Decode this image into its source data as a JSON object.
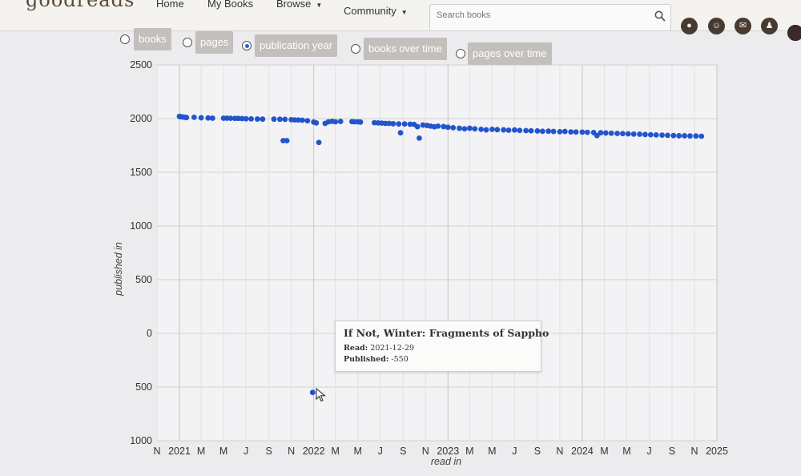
{
  "nav": {
    "logo": "goodreads",
    "home": "Home",
    "my_books": "My Books",
    "browse": "Browse",
    "community": "Community",
    "search_placeholder": "Search books"
  },
  "options": [
    {
      "label": "books",
      "selected": false
    },
    {
      "label": "pages",
      "selected": false
    },
    {
      "label": "publication year",
      "selected": true
    },
    {
      "label": "books over time",
      "selected": false
    },
    {
      "label": "pages over time",
      "selected": false
    }
  ],
  "tooltip": {
    "title": "If Not, Winter: Fragments of Sappho",
    "read_label": "Read:",
    "read_value": "2021-12-29",
    "published_label": "Published:",
    "published_value": "-550"
  },
  "chart_data": {
    "type": "scatter",
    "xlabel": "read in",
    "ylabel": "published in",
    "ylim": [
      -1000,
      2500
    ],
    "y_ticks": [
      2500,
      2000,
      1500,
      1000,
      500,
      0,
      -500,
      -1000
    ],
    "y_tick_labels": [
      "2500",
      "2000",
      "1500",
      "1000",
      "500",
      "0",
      "500",
      "1000"
    ],
    "xlim": [
      "2020-11-01",
      "2025-01-01"
    ],
    "x_tick_labels": [
      "N",
      "2021",
      "M",
      "M",
      "J",
      "S",
      "N",
      "2022",
      "M",
      "M",
      "J",
      "S",
      "N",
      "2023",
      "M",
      "M",
      "J",
      "S",
      "N",
      "2024",
      "M",
      "M",
      "J",
      "S",
      "N",
      "2025"
    ],
    "grid": true,
    "color": "#2255cc",
    "points": [
      {
        "x": "2021-01-01",
        "y": 2020
      },
      {
        "x": "2021-01-04",
        "y": 2018
      },
      {
        "x": "2021-01-08",
        "y": 2016
      },
      {
        "x": "2021-01-12",
        "y": 2014
      },
      {
        "x": "2021-01-16",
        "y": 2012
      },
      {
        "x": "2021-01-20",
        "y": 2010
      },
      {
        "x": "2021-02-10",
        "y": 2012
      },
      {
        "x": "2021-03-01",
        "y": 2008
      },
      {
        "x": "2021-03-20",
        "y": 2006
      },
      {
        "x": "2021-04-01",
        "y": 2004
      },
      {
        "x": "2021-05-01",
        "y": 2004
      },
      {
        "x": "2021-05-10",
        "y": 2004
      },
      {
        "x": "2021-05-20",
        "y": 2003
      },
      {
        "x": "2021-06-01",
        "y": 2002
      },
      {
        "x": "2021-06-10",
        "y": 2002
      },
      {
        "x": "2021-06-20",
        "y": 2000
      },
      {
        "x": "2021-07-01",
        "y": 1998
      },
      {
        "x": "2021-07-15",
        "y": 1997
      },
      {
        "x": "2021-08-01",
        "y": 1996
      },
      {
        "x": "2021-08-15",
        "y": 1995
      },
      {
        "x": "2021-09-15",
        "y": 1995
      },
      {
        "x": "2021-10-01",
        "y": 1994
      },
      {
        "x": "2021-10-15",
        "y": 1993
      },
      {
        "x": "2021-10-10",
        "y": 1795
      },
      {
        "x": "2021-10-20",
        "y": 1795
      },
      {
        "x": "2021-11-01",
        "y": 1990
      },
      {
        "x": "2021-11-10",
        "y": 1988
      },
      {
        "x": "2021-11-20",
        "y": 1987
      },
      {
        "x": "2021-12-01",
        "y": 1985
      },
      {
        "x": "2021-12-15",
        "y": 1980
      },
      {
        "x": "2021-12-29",
        "y": -550
      },
      {
        "x": "2022-01-01",
        "y": 1968
      },
      {
        "x": "2022-01-08",
        "y": 1960
      },
      {
        "x": "2022-01-15",
        "y": 1778
      },
      {
        "x": "2022-02-01",
        "y": 1955
      },
      {
        "x": "2022-02-10",
        "y": 1970
      },
      {
        "x": "2022-02-20",
        "y": 1975
      },
      {
        "x": "2022-03-01",
        "y": 1970
      },
      {
        "x": "2022-03-15",
        "y": 1974
      },
      {
        "x": "2022-04-15",
        "y": 1972
      },
      {
        "x": "2022-04-22",
        "y": 1970
      },
      {
        "x": "2022-05-01",
        "y": 1970
      },
      {
        "x": "2022-05-08",
        "y": 1968
      },
      {
        "x": "2022-06-15",
        "y": 1962
      },
      {
        "x": "2022-06-25",
        "y": 1960
      },
      {
        "x": "2022-07-05",
        "y": 1958
      },
      {
        "x": "2022-07-15",
        "y": 1955
      },
      {
        "x": "2022-07-25",
        "y": 1955
      },
      {
        "x": "2022-08-05",
        "y": 1952
      },
      {
        "x": "2022-08-20",
        "y": 1950
      },
      {
        "x": "2022-08-25",
        "y": 1868
      },
      {
        "x": "2022-09-05",
        "y": 1950
      },
      {
        "x": "2022-09-20",
        "y": 1948
      },
      {
        "x": "2022-10-01",
        "y": 1946
      },
      {
        "x": "2022-10-10",
        "y": 1925
      },
      {
        "x": "2022-10-15",
        "y": 1818
      },
      {
        "x": "2022-10-25",
        "y": 1940
      },
      {
        "x": "2022-11-05",
        "y": 1936
      },
      {
        "x": "2022-11-15",
        "y": 1930
      },
      {
        "x": "2022-11-25",
        "y": 1924
      },
      {
        "x": "2022-12-05",
        "y": 1930
      },
      {
        "x": "2022-12-20",
        "y": 1926
      },
      {
        "x": "2023-01-01",
        "y": 1920
      },
      {
        "x": "2023-01-15",
        "y": 1915
      },
      {
        "x": "2023-02-01",
        "y": 1910
      },
      {
        "x": "2023-02-15",
        "y": 1905
      },
      {
        "x": "2023-03-01",
        "y": 1910
      },
      {
        "x": "2023-03-15",
        "y": 1905
      },
      {
        "x": "2023-04-01",
        "y": 1900
      },
      {
        "x": "2023-04-15",
        "y": 1895
      },
      {
        "x": "2023-05-01",
        "y": 1900
      },
      {
        "x": "2023-05-15",
        "y": 1897
      },
      {
        "x": "2023-06-01",
        "y": 1895
      },
      {
        "x": "2023-06-15",
        "y": 1892
      },
      {
        "x": "2023-07-01",
        "y": 1894
      },
      {
        "x": "2023-07-15",
        "y": 1890
      },
      {
        "x": "2023-08-01",
        "y": 1888
      },
      {
        "x": "2023-08-15",
        "y": 1886
      },
      {
        "x": "2023-09-01",
        "y": 1885
      },
      {
        "x": "2023-09-15",
        "y": 1882
      },
      {
        "x": "2023-10-01",
        "y": 1883
      },
      {
        "x": "2023-10-15",
        "y": 1880
      },
      {
        "x": "2023-11-01",
        "y": 1878
      },
      {
        "x": "2023-11-15",
        "y": 1880
      },
      {
        "x": "2023-12-01",
        "y": 1876
      },
      {
        "x": "2023-12-15",
        "y": 1875
      },
      {
        "x": "2024-01-01",
        "y": 1874
      },
      {
        "x": "2024-01-15",
        "y": 1872
      },
      {
        "x": "2024-02-01",
        "y": 1870
      },
      {
        "x": "2024-02-10",
        "y": 1842
      },
      {
        "x": "2024-02-20",
        "y": 1868
      },
      {
        "x": "2024-03-05",
        "y": 1866
      },
      {
        "x": "2024-03-20",
        "y": 1864
      },
      {
        "x": "2024-04-05",
        "y": 1862
      },
      {
        "x": "2024-04-20",
        "y": 1860
      },
      {
        "x": "2024-05-05",
        "y": 1858
      },
      {
        "x": "2024-05-20",
        "y": 1856
      },
      {
        "x": "2024-06-05",
        "y": 1855
      },
      {
        "x": "2024-06-20",
        "y": 1852
      },
      {
        "x": "2024-07-05",
        "y": 1850
      },
      {
        "x": "2024-07-20",
        "y": 1848
      },
      {
        "x": "2024-08-05",
        "y": 1846
      },
      {
        "x": "2024-08-20",
        "y": 1844
      },
      {
        "x": "2024-09-05",
        "y": 1842
      },
      {
        "x": "2024-09-20",
        "y": 1840
      },
      {
        "x": "2024-10-05",
        "y": 1840
      },
      {
        "x": "2024-10-20",
        "y": 1838
      },
      {
        "x": "2024-11-05",
        "y": 1838
      },
      {
        "x": "2024-11-20",
        "y": 1836
      }
    ]
  }
}
